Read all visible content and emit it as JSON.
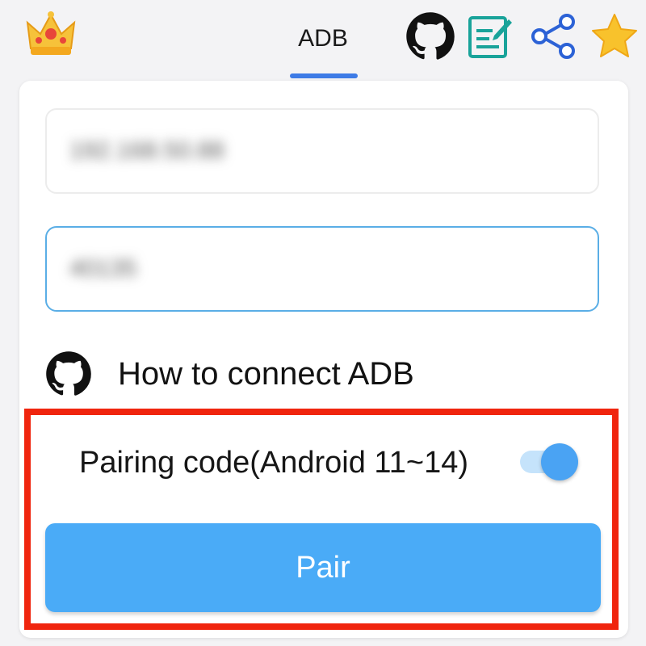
{
  "header": {
    "tab_label": "ADB",
    "icons": [
      "crown-icon",
      "github-icon",
      "note-edit-icon",
      "share-icon",
      "star-icon"
    ]
  },
  "form": {
    "ip_field": {
      "value": "192.168.50.88",
      "obscured": true
    },
    "port_field": {
      "value": "40135",
      "obscured": true,
      "focused": true
    }
  },
  "howto": {
    "label": "How to connect ADB"
  },
  "pairing": {
    "toggle_label": "Pairing code(Android 11~14)",
    "toggle_on": true,
    "button_label": "Pair"
  },
  "colors": {
    "accent": "#3d7be6",
    "button": "#4aabf7",
    "highlight": "#f0250e",
    "focus_border": "#5aaee6"
  }
}
